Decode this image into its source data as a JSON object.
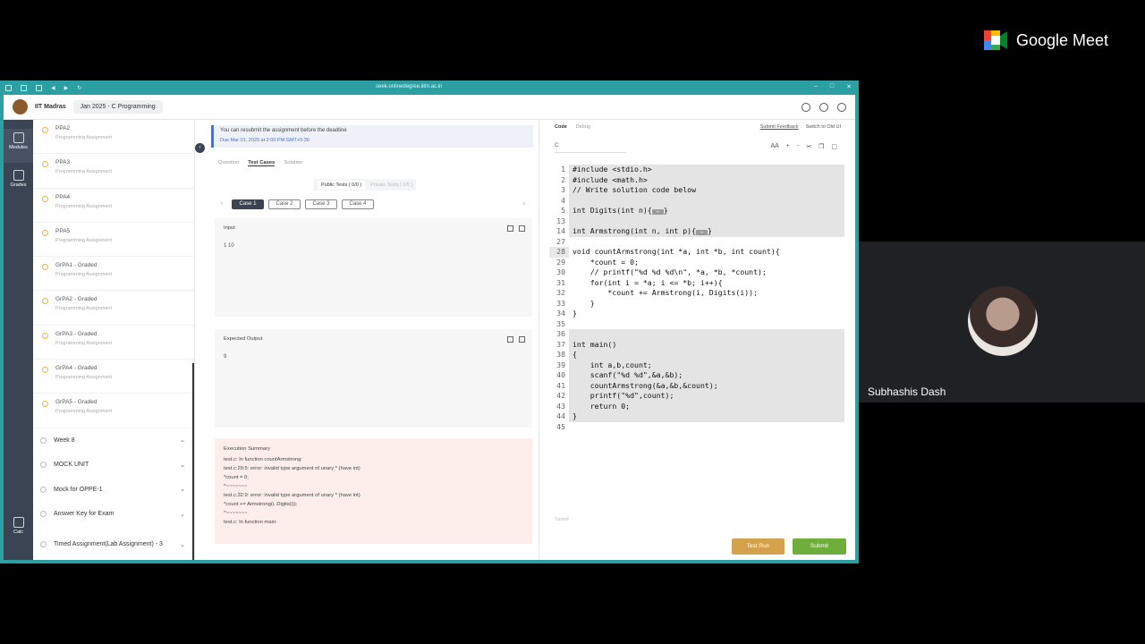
{
  "meet": {
    "brand": "Google Meet",
    "participant_name": "Subhashis Dash"
  },
  "browser": {
    "url": "seek.onlinedegree.iitm.ac.in"
  },
  "header": {
    "institute": "IIT Madras",
    "course": "Jan 2025 - C Programming"
  },
  "rail": {
    "items": [
      {
        "label": "Modules",
        "icon": "modules-icon"
      },
      {
        "label": "Grades",
        "icon": "grades-icon"
      },
      {
        "label": "Calc",
        "icon": "calculator-icon"
      }
    ]
  },
  "sidebar": {
    "items": [
      {
        "title": "PPA2",
        "subtitle": "Programming Assignment"
      },
      {
        "title": "PPA3",
        "subtitle": "Programming Assignment"
      },
      {
        "title": "PPA4",
        "subtitle": "Programming Assignment"
      },
      {
        "title": "PPA5",
        "subtitle": "Programming Assignment"
      },
      {
        "title": "GrPA1 - Graded",
        "subtitle": "Programming Assignment"
      },
      {
        "title": "GrPA2 - Graded",
        "subtitle": "Programming Assignment"
      },
      {
        "title": "GrPA3 - Graded",
        "subtitle": "Programming Assignment"
      },
      {
        "title": "GrPA4 - Graded",
        "subtitle": "Programming Assignment"
      },
      {
        "title": "GrPA5 - Graded",
        "subtitle": "Programming Assignment"
      }
    ],
    "weeks": [
      "Week 8",
      "MOCK UNIT",
      "Mock for OPPE-1",
      "Answer Key for Exam",
      "Timed Assignment(Lab Assignment) - 3"
    ]
  },
  "notice": {
    "text": "You can resubmit the assignment before the deadline",
    "due": "Due Mar 01, 2025 at 2:00 PM GMT+5:30"
  },
  "tabs": [
    "Question",
    "Test Cases",
    "Solution"
  ],
  "tests": {
    "public": "Public Tests ( 0/0 )",
    "private": "Private Tests ( 0/5 )"
  },
  "cases": [
    "Case 1",
    "Case 2",
    "Case 3",
    "Case 4"
  ],
  "input": {
    "label": "Input",
    "value": "1 10"
  },
  "expected": {
    "label": "Expected Output",
    "value": "9"
  },
  "exec": {
    "label": "Execution Summary",
    "lines": [
      "test.c: In function countArmstrong:",
      "test.c:29:5: error: invalid type argument of unary * (have int)",
      "*count = 0;",
      "^~~~~~~~",
      "test.c:32:9: error: invalid type argument of unary * (have int)",
      "*count += Armstrong(i, Digits(i));",
      "^~~~~~~~",
      "test.c: In function main:"
    ]
  },
  "code_panel": {
    "tabs": [
      "Code",
      "Debug"
    ],
    "links": [
      "Submit Feedback",
      "Switch to Old UI"
    ],
    "language": "C",
    "saved": "Saved",
    "lines": [
      {
        "n": "1",
        "code": "#include <stdio.h>"
      },
      {
        "n": "2",
        "code": "#include <math.h>"
      },
      {
        "n": "3",
        "code": "// Write solution code below"
      },
      {
        "n": "4",
        "code": ""
      },
      {
        "n": "5",
        "code": "int Digits(int n){"
      },
      {
        "n": "13",
        "code": ""
      },
      {
        "n": "14",
        "code": "int Armstrong(int n, int p){"
      },
      {
        "n": "27",
        "code": ""
      },
      {
        "n": "28",
        "code": "void countArmstrong(int *a, int *b, int count){"
      },
      {
        "n": "29",
        "code": "    *count = 0;"
      },
      {
        "n": "30",
        "code": "    // printf(\"%d %d %d\\n\", *a, *b, *count);"
      },
      {
        "n": "31",
        "code": "    for(int i = *a; i <= *b; i++){"
      },
      {
        "n": "32",
        "code": "        *count += Armstrong(i, Digits(i));"
      },
      {
        "n": "33",
        "code": "    }"
      },
      {
        "n": "34",
        "code": "}"
      },
      {
        "n": "35",
        "code": ""
      },
      {
        "n": "36",
        "code": ""
      },
      {
        "n": "37",
        "code": "int main()"
      },
      {
        "n": "38",
        "code": "{"
      },
      {
        "n": "39",
        "code": "    int a,b,count;"
      },
      {
        "n": "40",
        "code": "    scanf(\"%d %d\",&a,&b);"
      },
      {
        "n": "41",
        "code": "    countArmstrong(&a,&b,&count);"
      },
      {
        "n": "42",
        "code": "    printf(\"%d\",count);"
      },
      {
        "n": "43",
        "code": "    return 0;"
      },
      {
        "n": "44",
        "code": "}"
      },
      {
        "n": "45",
        "code": ""
      }
    ]
  },
  "buttons": {
    "test_run": "Test Run",
    "submit": "Submit"
  }
}
